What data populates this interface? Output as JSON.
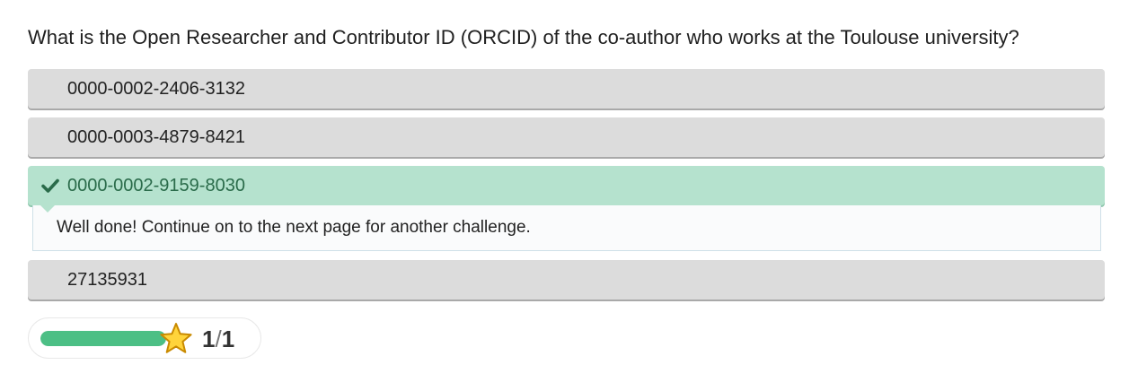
{
  "question": {
    "text": "What is the Open Researcher and Contributor ID (ORCID) of the co-author who works at the Toulouse university?"
  },
  "options": [
    {
      "label": "0000-0002-2406-3132",
      "state": "default"
    },
    {
      "label": "0000-0003-4879-8421",
      "state": "default"
    },
    {
      "label": "0000-0002-9159-8030",
      "state": "correct",
      "icon": "checkmark-icon"
    },
    {
      "label": "27135931",
      "state": "default"
    }
  ],
  "feedback": {
    "message": "Well done! Continue on to the next page for another challenge."
  },
  "progress": {
    "current": "1",
    "separator": "/",
    "total": "1",
    "fraction": 1.0,
    "icon": "star-icon"
  },
  "colors": {
    "option_bg": "#dcdcdc",
    "correct_bg": "#b5e2ce",
    "correct_text": "#2a6b4a",
    "check": "#2a6b4a",
    "progress_fill": "#4cbf85",
    "star_fill": "#ffd43b",
    "star_stroke": "#c98a00"
  }
}
